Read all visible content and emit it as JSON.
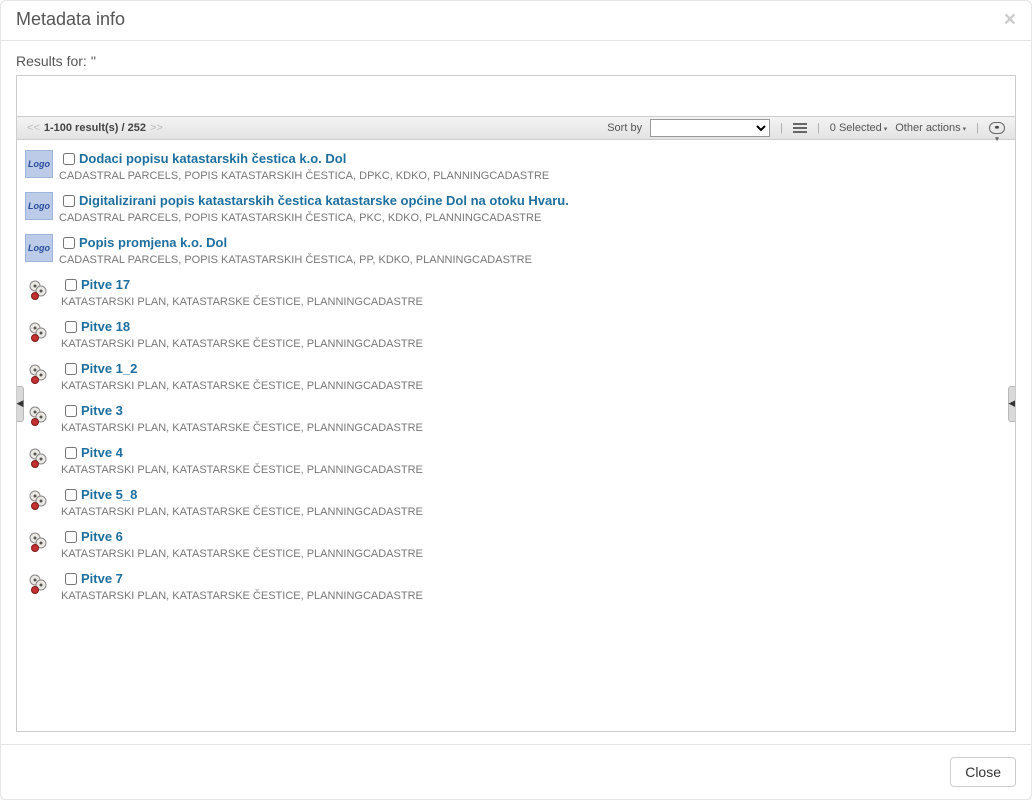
{
  "modal": {
    "title": "Metadata info",
    "close_glyph": "×",
    "results_for_label": "Results for: ''"
  },
  "toolbar": {
    "prev_glyph": "<<",
    "range_text": "1-100 result(s) / 252",
    "next_glyph": ">>",
    "sort_by_label": "Sort by",
    "selected_text": "0 Selected",
    "other_actions_text": "Other actions",
    "link_glyph": "⚭"
  },
  "logo_text": "Logo",
  "results": [
    {
      "icon": "logo",
      "title": "Dodaci popisu katastarskih čestica k.o. Dol",
      "keywords": "CADASTRAL PARCELS, POPIS KATASTARSKIH ČESTICA, DPKC, KDKO, PLANNINGCADASTRE"
    },
    {
      "icon": "logo",
      "title": "Digitalizirani popis katastarskih čestica katastarske općine Dol na otoku Hvaru.",
      "keywords": "CADASTRAL PARCELS, POPIS KATASTARSKIH ČESTICA, PKC, KDKO, PLANNINGCADASTRE"
    },
    {
      "icon": "logo",
      "title": "Popis promjena k.o. Dol",
      "keywords": "CADASTRAL PARCELS, POPIS KATASTARSKIH ČESTICA, PP, KDKO, PLANNINGCADASTRE"
    },
    {
      "icon": "map",
      "title": "Pitve 17",
      "keywords": "KATASTARSKI PLAN, KATASTARSKE ČESTICE, PLANNINGCADASTRE"
    },
    {
      "icon": "map",
      "title": "Pitve 18",
      "keywords": "KATASTARSKI PLAN, KATASTARSKE ČESTICE, PLANNINGCADASTRE"
    },
    {
      "icon": "map",
      "title": "Pitve 1_2",
      "keywords": "KATASTARSKI PLAN, KATASTARSKE ČESTICE, PLANNINGCADASTRE"
    },
    {
      "icon": "map",
      "title": "Pitve 3",
      "keywords": "KATASTARSKI PLAN, KATASTARSKE ČESTICE, PLANNINGCADASTRE"
    },
    {
      "icon": "map",
      "title": "Pitve 4",
      "keywords": "KATASTARSKI PLAN, KATASTARSKE ČESTICE, PLANNINGCADASTRE"
    },
    {
      "icon": "map",
      "title": "Pitve 5_8",
      "keywords": "KATASTARSKI PLAN, KATASTARSKE ČESTICE, PLANNINGCADASTRE"
    },
    {
      "icon": "map",
      "title": "Pitve 6",
      "keywords": "KATASTARSKI PLAN, KATASTARSKE ČESTICE, PLANNINGCADASTRE"
    },
    {
      "icon": "map",
      "title": "Pitve 7",
      "keywords": "KATASTARSKI PLAN, KATASTARSKE ČESTICE, PLANNINGCADASTRE"
    }
  ],
  "footer": {
    "close_label": "Close"
  }
}
